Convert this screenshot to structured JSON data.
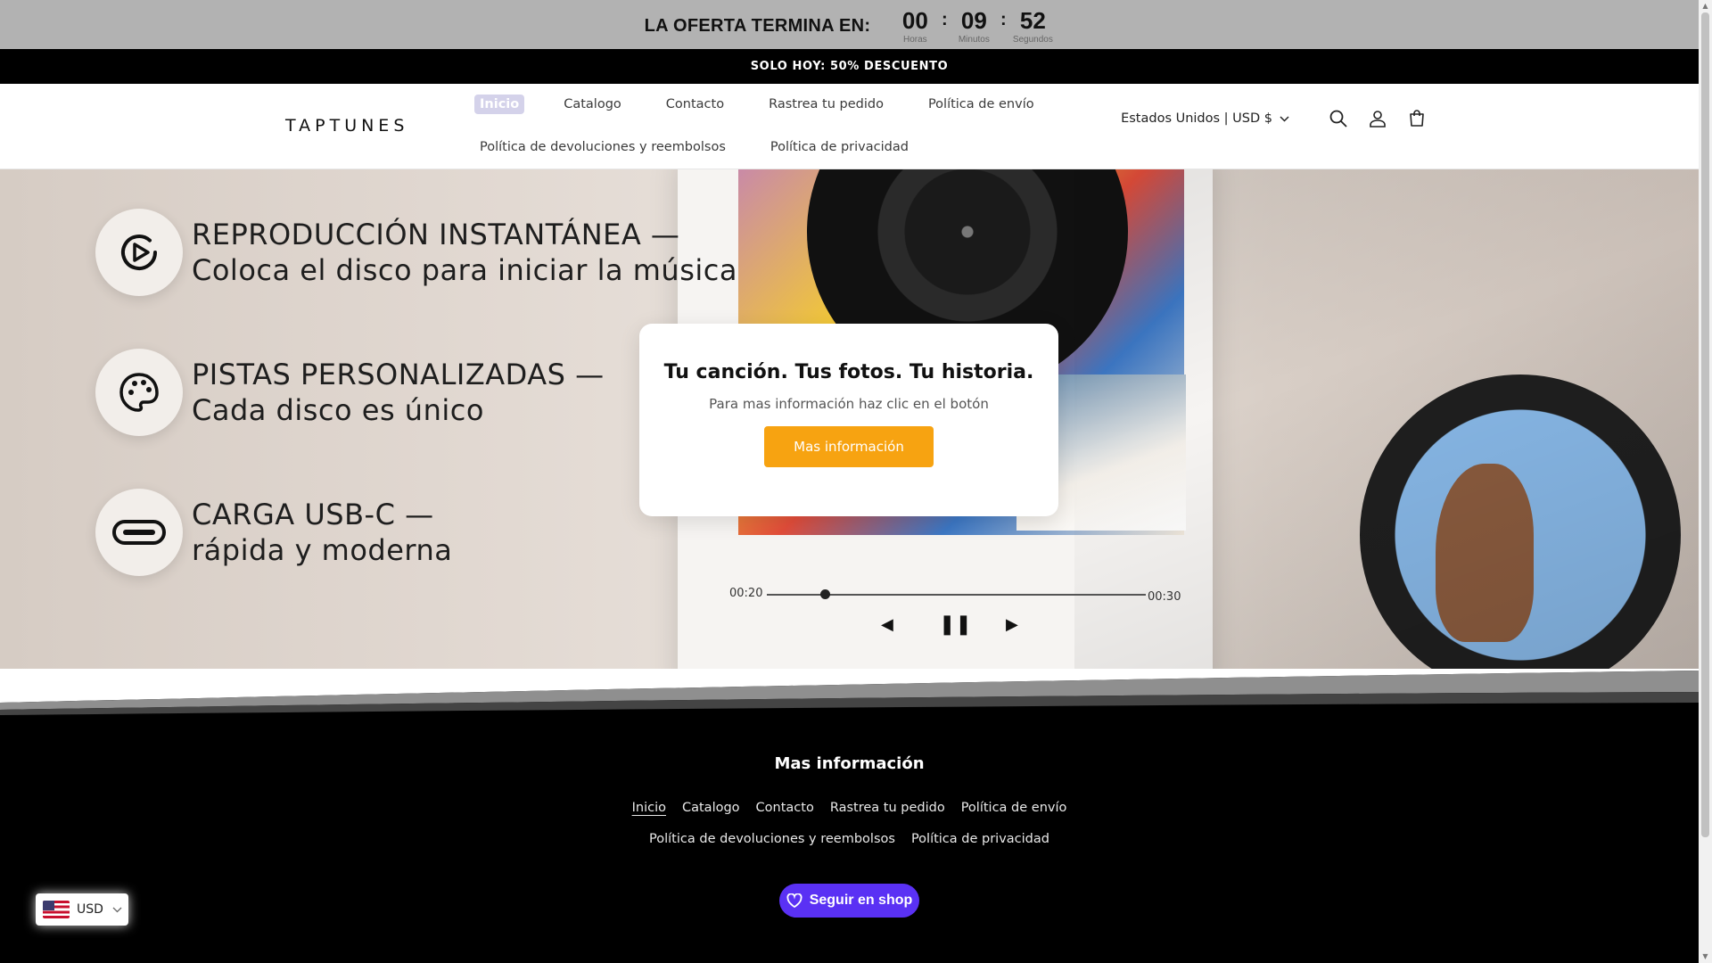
{
  "countdown": {
    "title": "LA OFERTA TERMINA EN:",
    "hours": "00",
    "hours_label": "Horas",
    "minutes": "09",
    "minutes_label": "Minutos",
    "seconds": "52",
    "seconds_label": "Segundos"
  },
  "announcement": "SOLO HOY: 50% DESCUENTO",
  "header": {
    "logo": "TAPTUNES",
    "nav_row1": [
      "Inicio",
      "Catalogo",
      "Contacto",
      "Rastrea tu pedido",
      "Política de envío"
    ],
    "nav_row2": [
      "Política de devoluciones y reembolsos",
      "Política de privacidad"
    ],
    "locale": "Estados Unidos | USD $",
    "icons": [
      "search-icon",
      "account-icon",
      "cart-icon"
    ]
  },
  "hero": {
    "features": [
      {
        "line1": "REPRODUCCIÓN INSTANTÁNEA —",
        "line2": "Coloca el disco para iniciar la música",
        "icon": "play-icon"
      },
      {
        "line1": "PISTAS PERSONALIZADAS —",
        "line2": "Cada disco es único",
        "icon": "palette-icon"
      },
      {
        "line1": "CARGA USB-C —",
        "line2": "rápida y moderna",
        "icon": "usb-c-icon"
      }
    ],
    "player": {
      "time_start": "00:20",
      "time_end": "00:30"
    },
    "popup": {
      "title": "Tu canción. Tus fotos. Tu historia.",
      "subtitle": "Para mas información haz clic en el botón",
      "button": "Mas información"
    }
  },
  "footer": {
    "title": "Mas información",
    "links_row1": [
      "Inicio",
      "Catalogo",
      "Contacto",
      "Rastrea tu pedido",
      "Política de envío"
    ],
    "links_row2": [
      "Política de devoluciones y reembolsos",
      "Política de privacidad"
    ],
    "shop_button": "Seguir en shop"
  },
  "currency_selector": {
    "value": "USD"
  },
  "colors": {
    "accent": "#f7a311",
    "shop": "#5a31f4",
    "active_nav": "#d4d2ea"
  }
}
